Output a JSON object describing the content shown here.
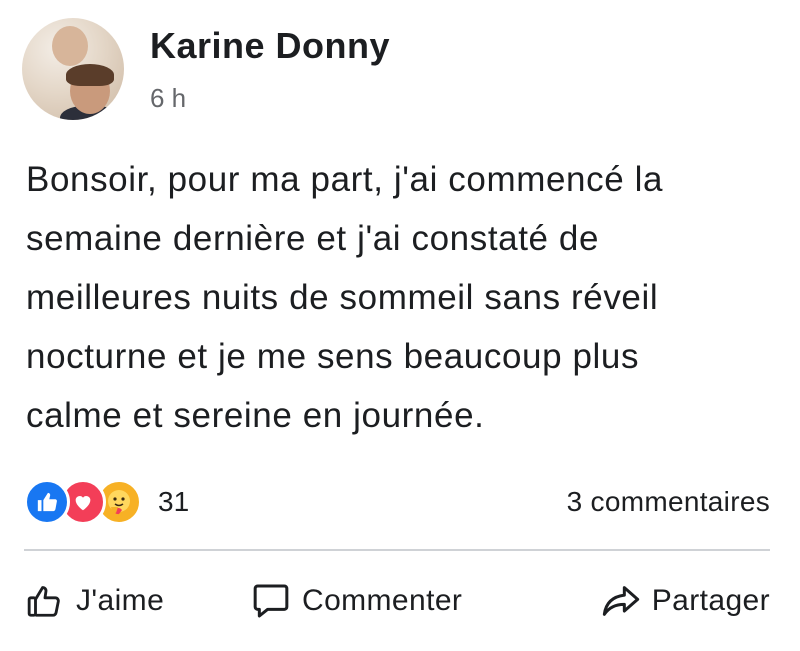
{
  "post": {
    "author": "Karine Donny",
    "time": "6 h",
    "text": "Bonsoir, pour ma part, j'ai commencé la\nsemaine dernière et j'ai constaté de\nmeilleures nuits de sommeil sans réveil\nnocturne et je me sens beaucoup plus\ncalme et sereine en journée.",
    "reactions": {
      "icons": [
        "like-icon",
        "love-icon",
        "care-icon"
      ],
      "count": "31"
    },
    "comments_count": "3 commentaires"
  },
  "actions": {
    "like": "J'aime",
    "comment": "Commenter",
    "share": "Partager"
  },
  "colors": {
    "like": "#1877f2",
    "love": "#f33e58",
    "care": "#f7b125",
    "text": "#1c1e21",
    "secondary": "#65676b",
    "divider": "#cfd2d6"
  }
}
